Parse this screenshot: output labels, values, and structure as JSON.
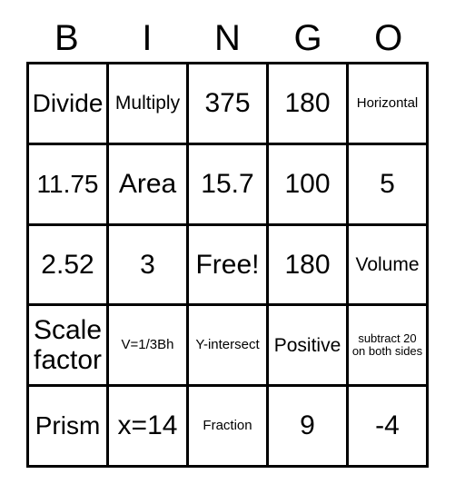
{
  "card": {
    "title_letters": [
      "B",
      "I",
      "N",
      "G",
      "O"
    ],
    "columns": 5,
    "rows": 5,
    "free_space_label": "Free!",
    "colors": {
      "background": "#ffffff",
      "text": "#000000",
      "border": "#000000"
    },
    "cells": [
      [
        {
          "text": "Divide",
          "size": "lg"
        },
        {
          "text": "Multiply",
          "size": "md"
        },
        {
          "text": "375",
          "size": "xl"
        },
        {
          "text": "180",
          "size": "xl"
        },
        {
          "text": "Horizontal",
          "size": "sm"
        }
      ],
      [
        {
          "text": "11.75",
          "size": "lg"
        },
        {
          "text": "Area",
          "size": "xl"
        },
        {
          "text": "15.7",
          "size": "xl"
        },
        {
          "text": "100",
          "size": "xl"
        },
        {
          "text": "5",
          "size": "xl"
        }
      ],
      [
        {
          "text": "2.52",
          "size": "xl"
        },
        {
          "text": "3",
          "size": "xl"
        },
        {
          "text": "Free!",
          "size": "xl"
        },
        {
          "text": "180",
          "size": "xl"
        },
        {
          "text": "Volume",
          "size": "md"
        }
      ],
      [
        {
          "text": "Scale factor",
          "size": "xl"
        },
        {
          "text": "V=1/3Bh",
          "size": "sm"
        },
        {
          "text": "Y-intersect",
          "size": "sm"
        },
        {
          "text": "Positive",
          "size": "md"
        },
        {
          "text": "subtract 20 on both sides",
          "size": "xs"
        }
      ],
      [
        {
          "text": "Prism",
          "size": "lg"
        },
        {
          "text": "x=14",
          "size": "xl"
        },
        {
          "text": "Fraction",
          "size": "sm"
        },
        {
          "text": "9",
          "size": "xl"
        },
        {
          "text": "-4",
          "size": "xl"
        }
      ]
    ]
  }
}
